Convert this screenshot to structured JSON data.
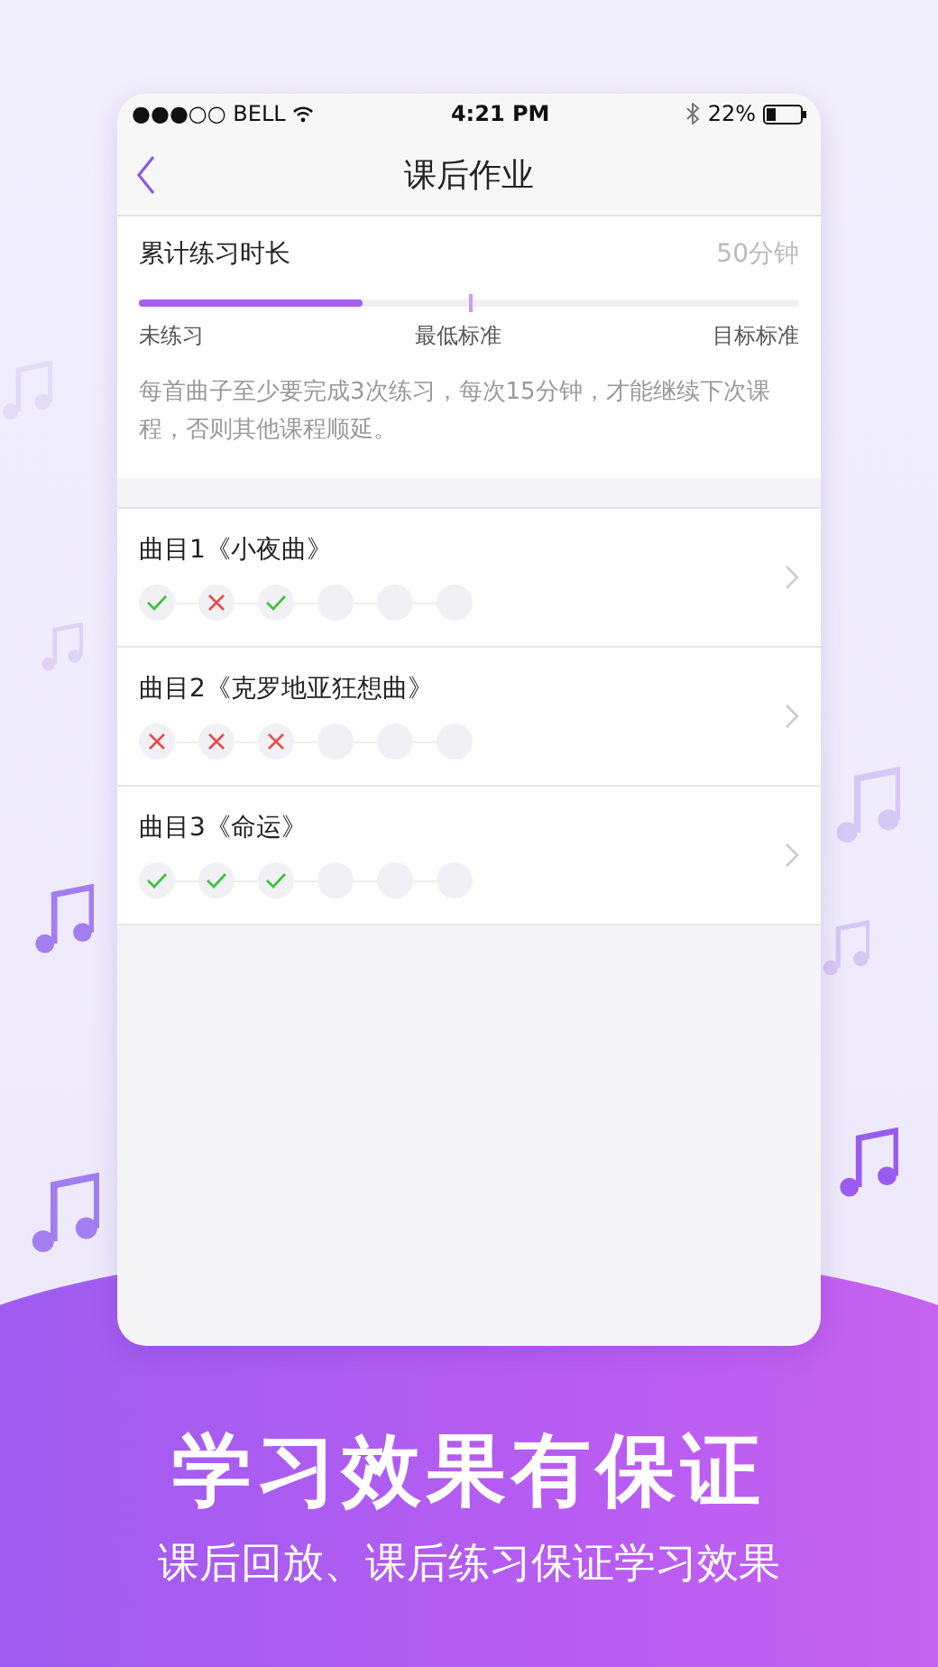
{
  "status_bar": {
    "carrier": "●●●○○ BELL",
    "time": "4:21 PM",
    "battery": "22%"
  },
  "nav": {
    "title": "课后作业"
  },
  "summary": {
    "title": "累计练习时长",
    "total": "50分钟",
    "level": 0.34,
    "labels": [
      "未练习",
      "最低标准",
      "目标标准"
    ],
    "note": "每首曲子至少要完成3次练习，每次15分钟，才能继续下次课程，否则其他课程顺延。"
  },
  "pieces": [
    {
      "title": "曲目1《小夜曲》",
      "attempts": [
        {
          "kind": "pass"
        },
        {
          "kind": "fail"
        },
        {
          "kind": "pass"
        },
        {
          "kind": "empty"
        },
        {
          "kind": "empty"
        },
        {
          "kind": "empty"
        }
      ]
    },
    {
      "title": "曲目2《克罗地亚狂想曲》",
      "attempts": [
        {
          "kind": "fail"
        },
        {
          "kind": "fail"
        },
        {
          "kind": "fail"
        },
        {
          "kind": "empty"
        },
        {
          "kind": "empty"
        },
        {
          "kind": "empty"
        }
      ]
    },
    {
      "title": "曲目3《命运》",
      "attempts": [
        {
          "kind": "pass"
        },
        {
          "kind": "pass"
        },
        {
          "kind": "pass"
        },
        {
          "kind": "empty"
        },
        {
          "kind": "empty"
        },
        {
          "kind": "empty"
        }
      ]
    }
  ],
  "headline": "学习效果有保证",
  "subline": "课后回放、课后练习保证学习效果"
}
